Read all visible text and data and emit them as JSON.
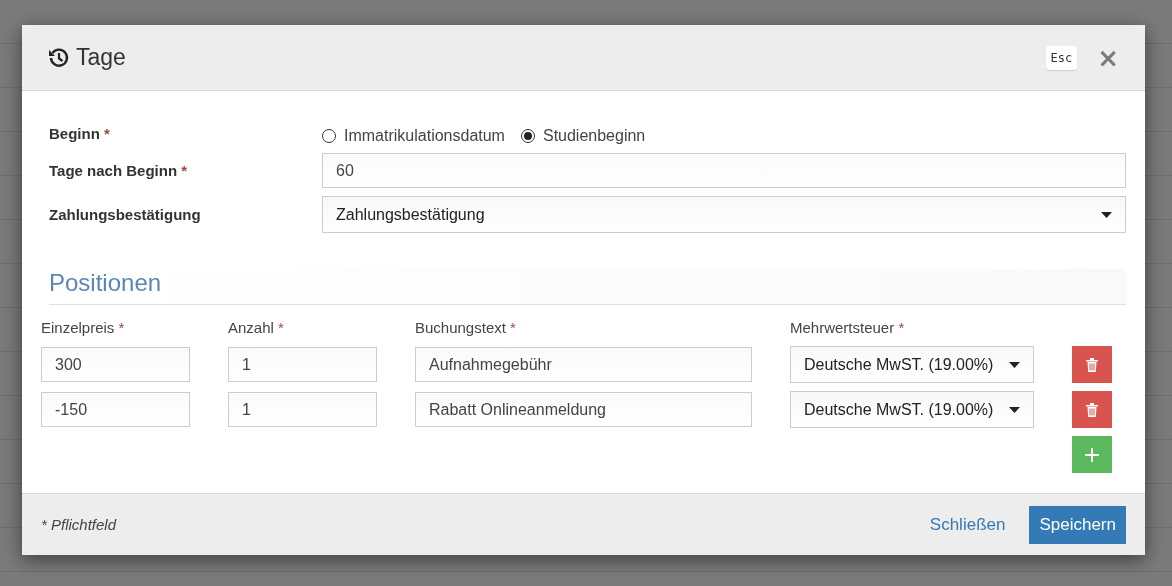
{
  "dialog": {
    "title": "Tage",
    "esc_key": "Esc",
    "close_symbol": "×"
  },
  "required_mark": "*",
  "form": {
    "fields": [
      {
        "kind": "radio",
        "label": "Beginn",
        "required": true,
        "options": [
          {
            "label": "Immatrikulationsdatum",
            "selected": false
          },
          {
            "label": "Studienbeginn",
            "selected": true
          }
        ]
      },
      {
        "kind": "text",
        "label": "Tage nach Beginn",
        "required": true,
        "value": "60"
      },
      {
        "kind": "select",
        "label": "Zahlungsbestätigung",
        "required": false,
        "value": "Zahlungsbestätigung"
      }
    ]
  },
  "positions": {
    "heading": "Positionen",
    "columns": [
      {
        "label": "Einzelpreis",
        "required": true
      },
      {
        "label": "Anzahl",
        "required": true
      },
      {
        "label": "Buchungstext",
        "required": true
      },
      {
        "label": "Mehrwertsteuer",
        "required": true
      }
    ],
    "rows": [
      {
        "price": "300",
        "quantity": "1",
        "text": "Aufnahmegebühr",
        "vat": "Deutsche MwST. (19.00%)"
      },
      {
        "price": "-150",
        "quantity": "1",
        "text": "Rabatt Onlineanmeldung",
        "vat": "Deutsche MwST. (19.00%)"
      }
    ]
  },
  "footer": {
    "required_note": "* Pflichtfeld",
    "buttons": [
      {
        "kind": "link",
        "label": "Schließen"
      },
      {
        "kind": "primary",
        "label": "Speichern"
      }
    ]
  }
}
